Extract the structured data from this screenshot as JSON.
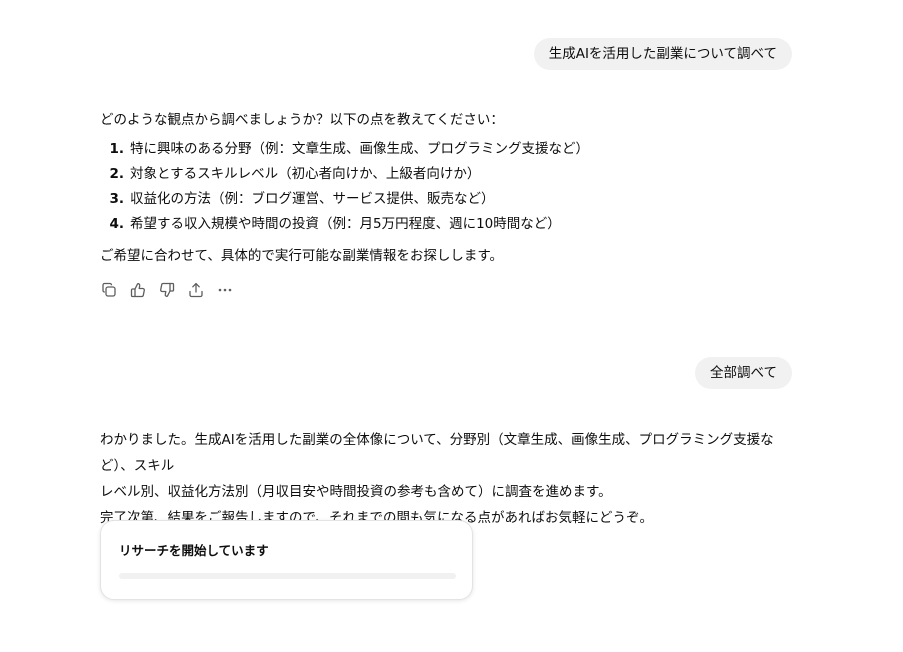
{
  "conversation": {
    "user_message_1": "生成AIを活用した副業について調べて",
    "assistant_message_1": {
      "intro": "どのような観点から調べましょうか？以下の点を教えてください：",
      "items": [
        {
          "number": "1.",
          "text": "特に興味のある分野（例：文章生成、画像生成、プログラミング支援など）"
        },
        {
          "number": "2.",
          "text": "対象とするスキルレベル（初心者向けか、上級者向けか）"
        },
        {
          "number": "3.",
          "text": "収益化の方法（例：ブログ運営、サービス提供、販売など）"
        },
        {
          "number": "4.",
          "text": "希望する収入規模や時間の投資（例：月5万円程度、週に10時間など）"
        }
      ],
      "closing": "ご希望に合わせて、具体的で実行可能な副業情報をお探しします。"
    },
    "actions": [
      {
        "name": "copy-icon"
      },
      {
        "name": "thumbs-up-icon"
      },
      {
        "name": "thumbs-down-icon"
      },
      {
        "name": "share-icon"
      },
      {
        "name": "more-icon"
      }
    ],
    "user_message_2": "全部調べて",
    "assistant_message_2": {
      "line_1": "わかりました。生成AIを活用した副業の全体像について、分野別（文章生成、画像生成、プログラミング支援など）、スキル",
      "line_2": "レベル別、収益化方法別（月収目安や時間投資の参考も含めて）に調査を進めます。",
      "line_3": "完了次第、結果をご報告しますので、それまでの間も気になる点があればお気軽にどうぞ。"
    },
    "research_card": {
      "title": "リサーチを開始しています",
      "progress": 0.0
    }
  }
}
